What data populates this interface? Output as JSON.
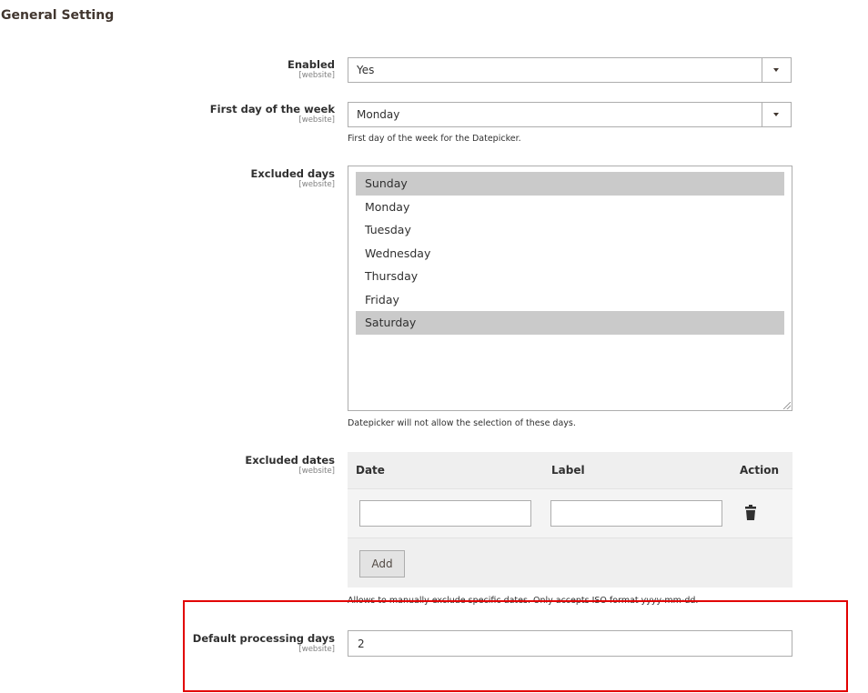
{
  "section": {
    "title": "General Setting"
  },
  "scope_label": "[website]",
  "fields": {
    "enabled": {
      "label": "Enabled",
      "value": "Yes"
    },
    "first_day": {
      "label": "First day of the week",
      "value": "Monday",
      "note": "First day of the week for the Datepicker."
    },
    "excluded_days": {
      "label": "Excluded days",
      "options": [
        {
          "label": "Sunday",
          "selected": true
        },
        {
          "label": "Monday",
          "selected": false
        },
        {
          "label": "Tuesday",
          "selected": false
        },
        {
          "label": "Wednesday",
          "selected": false
        },
        {
          "label": "Thursday",
          "selected": false
        },
        {
          "label": "Friday",
          "selected": false
        },
        {
          "label": "Saturday",
          "selected": true
        }
      ],
      "note": "Datepicker will not allow the selection of these days."
    },
    "excluded_dates": {
      "label": "Excluded dates",
      "columns": [
        "Date",
        "Label",
        "Action"
      ],
      "rows": [
        {
          "date": "",
          "label": ""
        }
      ],
      "add_label": "Add",
      "note": "Allows to manually exclude specific dates. Only accepts ISO format yyyy-mm-dd."
    },
    "default_processing_days": {
      "label": "Default processing days",
      "value": "2"
    }
  },
  "colors": {
    "highlight": "#e20000",
    "selected_option": "#cacaca"
  }
}
